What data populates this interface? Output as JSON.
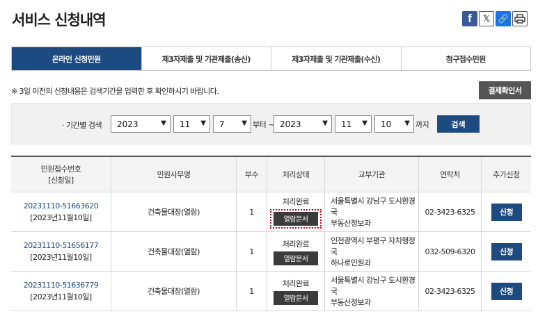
{
  "page": {
    "title": "서비스 신청내역"
  },
  "share": {
    "facebook": "f",
    "x": "𝕏",
    "link": "🔗",
    "print": "⎙"
  },
  "tabs": [
    {
      "label": "온라인 신청민원",
      "active": true
    },
    {
      "label": "제3자제출 및 기관제출(송신)",
      "active": false
    },
    {
      "label": "제3자제출 및 기관제출(수신)",
      "active": false
    },
    {
      "label": "청구접수민원",
      "active": false
    }
  ],
  "notice": "※ 3일 이전의 신청내용은 검색기간을 입력한 후 확인하시기 바랍니다.",
  "pay_button": "결제확인서",
  "search": {
    "label": "· 기간별 검색",
    "from": {
      "year": "2023",
      "month": "11",
      "day": "7"
    },
    "from_suffix": "부터 ~",
    "to": {
      "year": "2023",
      "month": "11",
      "day": "10"
    },
    "to_suffix": "까지",
    "button": "검색"
  },
  "table": {
    "headers": {
      "req_no": "민원접수번호",
      "req_date": "[신청일]",
      "name": "민원사무명",
      "copies": "부수",
      "status": "처리상태",
      "agency": "교부기관",
      "contact": "연락처",
      "extra": "추가신청"
    },
    "rows": [
      {
        "req_no": "20231110-51663620",
        "date": "[2023년11월10일]",
        "name": "건축물대장(열람)",
        "copies": "1",
        "status": "처리완료",
        "view": "열람문서",
        "agency1": "서울특별시 강남구 도시환경국",
        "agency2": "부동산정보과",
        "contact": "02-3423-6325",
        "apply": "신청",
        "highlight": true
      },
      {
        "req_no": "20231110-51656177",
        "date": "[2023년11월10일]",
        "name": "건축물대장(열람)",
        "copies": "1",
        "status": "처리완료",
        "view": "열람문서",
        "agency1": "인천광역시 부평구 자치행정국",
        "agency2": "하나로민원과",
        "contact": "032-509-6320",
        "apply": "신청",
        "highlight": false
      },
      {
        "req_no": "20231110-51636779",
        "date": "[2023년11월10일]",
        "name": "건축물대장(열람)",
        "copies": "1",
        "status": "처리완료",
        "view": "열람문서",
        "agency1": "서울특별시 강남구 도시환경국",
        "agency2": "부동산정보과",
        "contact": "02-3423-6325",
        "apply": "신청",
        "highlight": false
      }
    ]
  },
  "colors": {
    "primary": "#1d4a80",
    "dark_button": "#3b3b3b",
    "highlight": "#d0021b",
    "facebook": "#3b5998"
  }
}
